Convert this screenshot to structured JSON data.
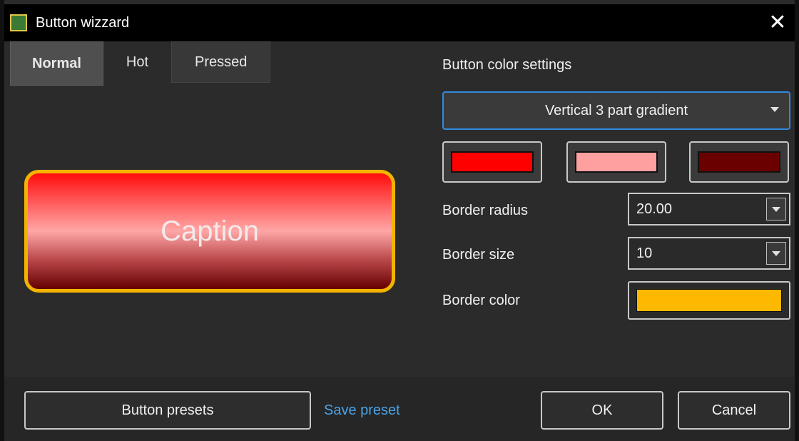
{
  "window": {
    "title": "Button wizzard"
  },
  "tabs": [
    {
      "label": "Normal"
    },
    {
      "label": "Hot"
    },
    {
      "label": "Pressed"
    }
  ],
  "preview": {
    "caption": "Caption"
  },
  "settings": {
    "section_label": "Button color settings",
    "gradient_type": "Vertical 3 part gradient",
    "gradient_colors": [
      "#ff0000",
      "#ffa0a0",
      "#6b0000"
    ],
    "border_radius_label": "Border radius",
    "border_radius_value": "20.00",
    "border_size_label": "Border size",
    "border_size_value": "10",
    "border_color_label": "Border color",
    "border_color": "#ffb800"
  },
  "footer": {
    "presets_label": "Button presets",
    "save_preset_label": "Save preset",
    "ok_label": "OK",
    "cancel_label": "Cancel"
  },
  "icons": {
    "app": "app-icon",
    "close": "close-icon",
    "dropdown": "chevron-down-icon"
  }
}
